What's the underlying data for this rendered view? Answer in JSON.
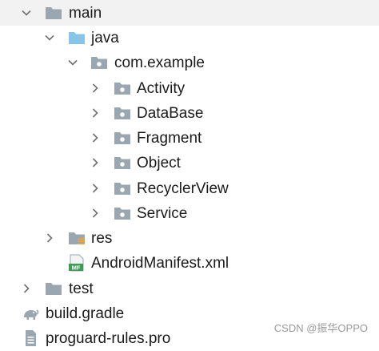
{
  "tree": {
    "items": [
      {
        "label": "main"
      },
      {
        "label": "java"
      },
      {
        "label": "com.example"
      },
      {
        "label": "Activity"
      },
      {
        "label": "DataBase"
      },
      {
        "label": "Fragment"
      },
      {
        "label": "Object"
      },
      {
        "label": "RecyclerView"
      },
      {
        "label": "Service"
      },
      {
        "label": "res"
      },
      {
        "label": "AndroidManifest.xml",
        "icon_text": "MF"
      },
      {
        "label": "test"
      },
      {
        "label": "build.gradle"
      },
      {
        "label": "proguard-rules.pro"
      }
    ]
  },
  "watermark": "CSDN @振华OPPO",
  "colors": {
    "folder_gray": "#9aa7b0",
    "source_folder_blue": "#87c5e8",
    "arrow": "#6e6e6e",
    "selected_row": "#f2f2f2"
  }
}
